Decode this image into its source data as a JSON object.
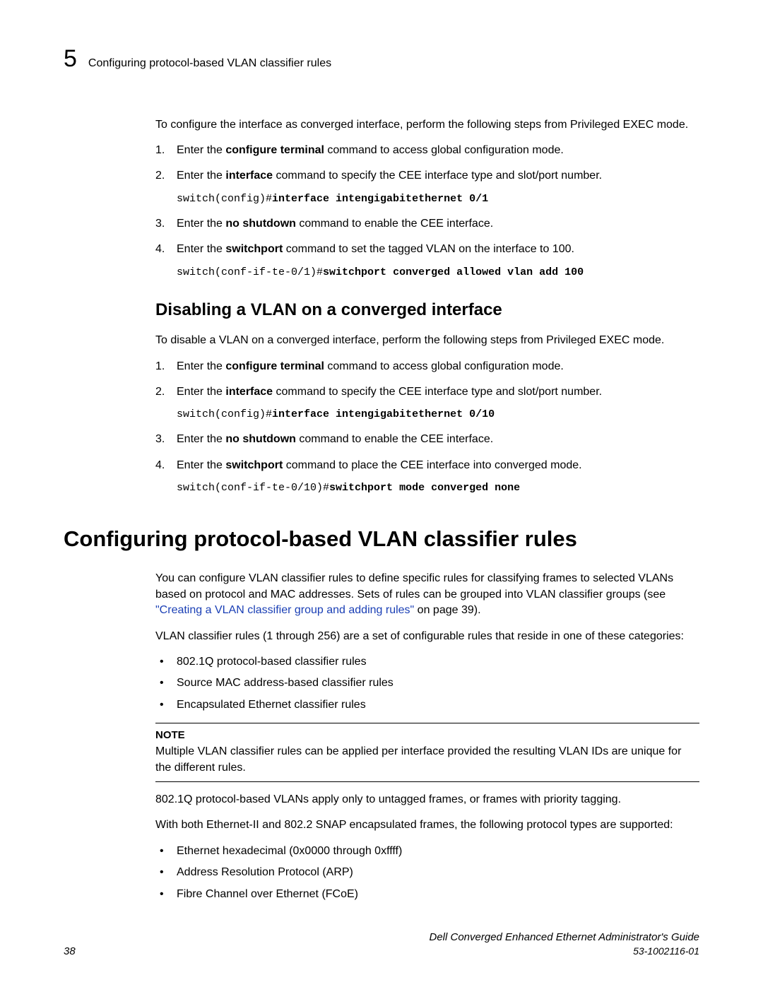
{
  "header": {
    "chapter_num": "5",
    "running_title": "Configuring protocol-based VLAN classifier rules"
  },
  "section_a": {
    "intro": "To configure the interface as converged interface, perform the following steps from Privileged EXEC mode.",
    "steps": [
      {
        "pre": "Enter the ",
        "bold": "configure terminal",
        "post": " command to access global configuration mode."
      },
      {
        "pre": "Enter the ",
        "bold": "interface",
        "post": " command to specify the CEE interface type and slot/port number.",
        "code_prefix": "switch(config)#",
        "code_bold": "interface intengigabitethernet 0/1"
      },
      {
        "pre": "Enter the ",
        "bold": "no shutdown",
        "post": " command to enable the CEE interface."
      },
      {
        "pre": "Enter the ",
        "bold": "switchport",
        "post": " command to set the tagged VLAN on the interface to 100.",
        "code_prefix": "switch(conf-if-te-0/1)#",
        "code_bold": "switchport converged allowed vlan add 100"
      }
    ]
  },
  "section_b": {
    "heading": "Disabling a VLAN on a converged interface",
    "intro": "To disable a VLAN on a converged interface, perform the following steps from Privileged EXEC mode.",
    "steps": [
      {
        "pre": "Enter the ",
        "bold": "configure terminal",
        "post": " command to access global configuration mode."
      },
      {
        "pre": "Enter the ",
        "bold": "interface",
        "post": " command to specify the CEE interface type and slot/port number.",
        "code_prefix": "switch(config)#",
        "code_bold": "interface intengigabitethernet 0/10"
      },
      {
        "pre": "Enter the ",
        "bold": "no shutdown",
        "post": " command to enable the CEE interface."
      },
      {
        "pre": "Enter the ",
        "bold": "switchport",
        "post": " command to place the CEE interface into converged mode.",
        "code_prefix": "switch(conf-if-te-0/10)#",
        "code_bold": "switchport mode converged none"
      }
    ]
  },
  "section_c": {
    "heading": "Configuring protocol-based VLAN classifier rules",
    "para1_pre": "You can configure VLAN classifier rules to define specific rules for classifying frames to selected VLANs based on protocol and MAC addresses. Sets of rules can be grouped into VLAN classifier groups (see ",
    "para1_link": "\"Creating a VLAN classifier group and adding rules\"",
    "para1_post": " on page 39).",
    "para2": "VLAN classifier rules (1 through 256) are a set of configurable rules that reside in one of these categories:",
    "bullets1": [
      "802.1Q protocol-based classifier rules",
      "Source MAC address-based classifier rules",
      "Encapsulated Ethernet classifier rules"
    ],
    "note_label": "NOTE",
    "note_text": "Multiple VLAN classifier rules can be applied per interface provided the resulting VLAN IDs are unique for the different rules.",
    "para3": "802.1Q protocol-based VLANs apply only to untagged frames, or frames with priority tagging.",
    "para4": "With both Ethernet-II and 802.2 SNAP encapsulated frames, the following protocol types are supported:",
    "bullets2": [
      "Ethernet hexadecimal (0x0000 through 0xffff)",
      "Address Resolution Protocol (ARP)",
      "Fibre Channel over Ethernet (FCoE)"
    ]
  },
  "footer": {
    "page_num": "38",
    "doc_title": "Dell Converged Enhanced Ethernet Administrator's Guide",
    "doc_id": "53-1002116-01"
  }
}
